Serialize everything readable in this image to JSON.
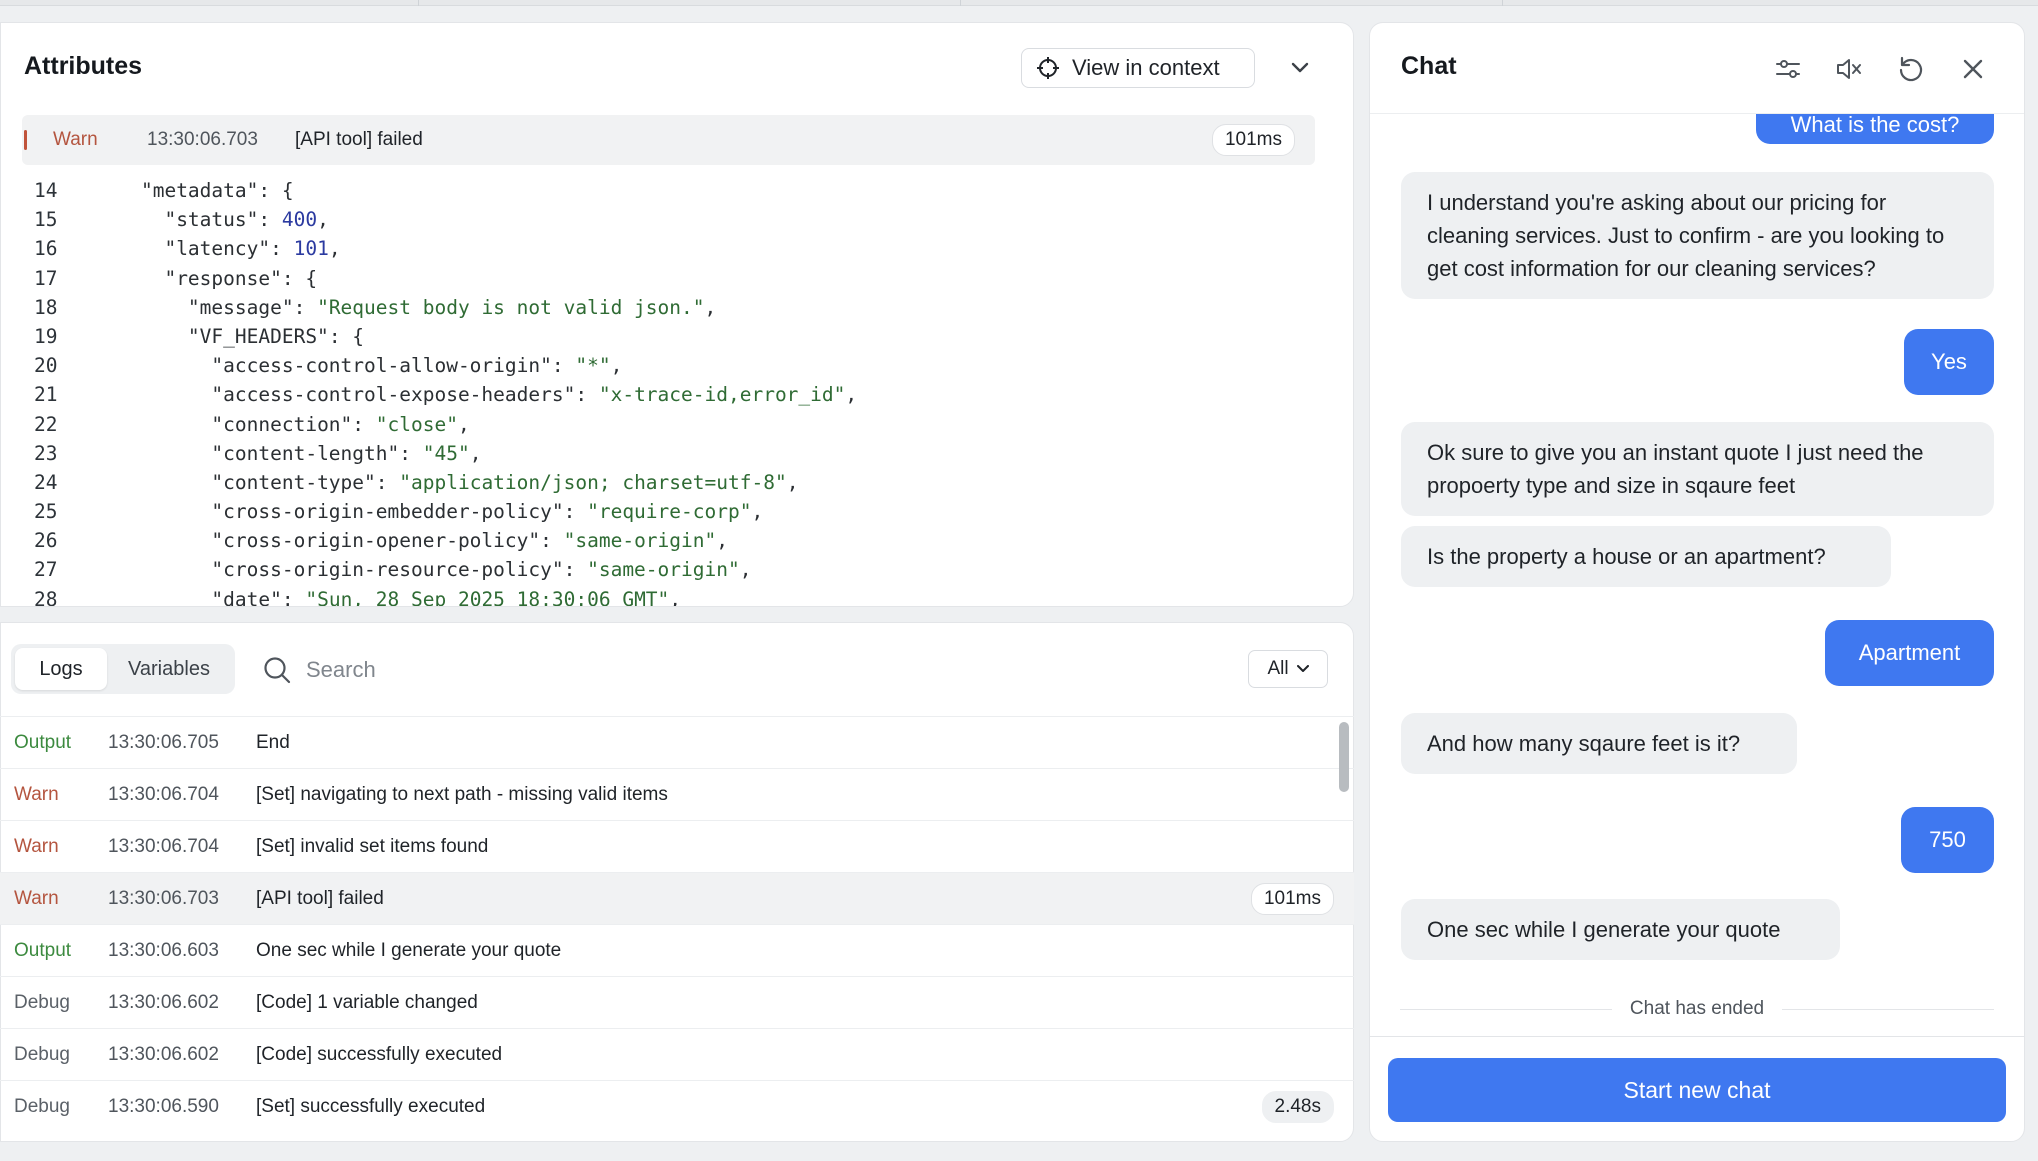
{
  "attributes": {
    "title": "Attributes",
    "view_in_context": "View in context",
    "selected_log": {
      "level": "Warn",
      "timestamp": "13:30:06.703",
      "message": "[API tool] failed",
      "duration": "101ms"
    },
    "code_lines": [
      {
        "n": "14",
        "parts": [
          {
            "t": "p",
            "v": "    "
          },
          {
            "t": "key",
            "v": "\"metadata\""
          },
          {
            "t": "p",
            "v": ": {"
          }
        ]
      },
      {
        "n": "15",
        "parts": [
          {
            "t": "p",
            "v": "      "
          },
          {
            "t": "key",
            "v": "\"status\""
          },
          {
            "t": "p",
            "v": ": "
          },
          {
            "t": "num",
            "v": "400"
          },
          {
            "t": "p",
            "v": ","
          }
        ]
      },
      {
        "n": "16",
        "parts": [
          {
            "t": "p",
            "v": "      "
          },
          {
            "t": "key",
            "v": "\"latency\""
          },
          {
            "t": "p",
            "v": ": "
          },
          {
            "t": "num",
            "v": "101"
          },
          {
            "t": "p",
            "v": ","
          }
        ]
      },
      {
        "n": "17",
        "parts": [
          {
            "t": "p",
            "v": "      "
          },
          {
            "t": "key",
            "v": "\"response\""
          },
          {
            "t": "p",
            "v": ": {"
          }
        ]
      },
      {
        "n": "18",
        "parts": [
          {
            "t": "p",
            "v": "        "
          },
          {
            "t": "key",
            "v": "\"message\""
          },
          {
            "t": "p",
            "v": ": "
          },
          {
            "t": "str",
            "v": "\"Request body is not valid json.\""
          },
          {
            "t": "p",
            "v": ","
          }
        ]
      },
      {
        "n": "19",
        "parts": [
          {
            "t": "p",
            "v": "        "
          },
          {
            "t": "key",
            "v": "\"VF_HEADERS\""
          },
          {
            "t": "p",
            "v": ": {"
          }
        ]
      },
      {
        "n": "20",
        "parts": [
          {
            "t": "p",
            "v": "          "
          },
          {
            "t": "key",
            "v": "\"access-control-allow-origin\""
          },
          {
            "t": "p",
            "v": ": "
          },
          {
            "t": "str",
            "v": "\"*\""
          },
          {
            "t": "p",
            "v": ","
          }
        ]
      },
      {
        "n": "21",
        "parts": [
          {
            "t": "p",
            "v": "          "
          },
          {
            "t": "key",
            "v": "\"access-control-expose-headers\""
          },
          {
            "t": "p",
            "v": ": "
          },
          {
            "t": "str",
            "v": "\"x-trace-id,error_id\""
          },
          {
            "t": "p",
            "v": ","
          }
        ]
      },
      {
        "n": "22",
        "parts": [
          {
            "t": "p",
            "v": "          "
          },
          {
            "t": "key",
            "v": "\"connection\""
          },
          {
            "t": "p",
            "v": ": "
          },
          {
            "t": "str",
            "v": "\"close\""
          },
          {
            "t": "p",
            "v": ","
          }
        ]
      },
      {
        "n": "23",
        "parts": [
          {
            "t": "p",
            "v": "          "
          },
          {
            "t": "key",
            "v": "\"content-length\""
          },
          {
            "t": "p",
            "v": ": "
          },
          {
            "t": "str",
            "v": "\"45\""
          },
          {
            "t": "p",
            "v": ","
          }
        ]
      },
      {
        "n": "24",
        "parts": [
          {
            "t": "p",
            "v": "          "
          },
          {
            "t": "key",
            "v": "\"content-type\""
          },
          {
            "t": "p",
            "v": ": "
          },
          {
            "t": "str",
            "v": "\"application/json; charset=utf-8\""
          },
          {
            "t": "p",
            "v": ","
          }
        ]
      },
      {
        "n": "25",
        "parts": [
          {
            "t": "p",
            "v": "          "
          },
          {
            "t": "key",
            "v": "\"cross-origin-embedder-policy\""
          },
          {
            "t": "p",
            "v": ": "
          },
          {
            "t": "str",
            "v": "\"require-corp\""
          },
          {
            "t": "p",
            "v": ","
          }
        ]
      },
      {
        "n": "26",
        "parts": [
          {
            "t": "p",
            "v": "          "
          },
          {
            "t": "key",
            "v": "\"cross-origin-opener-policy\""
          },
          {
            "t": "p",
            "v": ": "
          },
          {
            "t": "str",
            "v": "\"same-origin\""
          },
          {
            "t": "p",
            "v": ","
          }
        ]
      },
      {
        "n": "27",
        "parts": [
          {
            "t": "p",
            "v": "          "
          },
          {
            "t": "key",
            "v": "\"cross-origin-resource-policy\""
          },
          {
            "t": "p",
            "v": ": "
          },
          {
            "t": "str",
            "v": "\"same-origin\""
          },
          {
            "t": "p",
            "v": ","
          }
        ]
      },
      {
        "n": "28",
        "parts": [
          {
            "t": "p",
            "v": "          "
          },
          {
            "t": "key",
            "v": "\"date\""
          },
          {
            "t": "p",
            "v": ": "
          },
          {
            "t": "str",
            "v": "\"Sun, 28 Sep 2025 18:30:06 GMT\""
          },
          {
            "t": "p",
            "v": ","
          }
        ]
      }
    ]
  },
  "logs": {
    "tabs": {
      "logs": "Logs",
      "variables": "Variables"
    },
    "search_placeholder": "Search",
    "filter": "All",
    "rows": [
      {
        "level": "Output",
        "timestamp": "13:30:06.705",
        "message": "End"
      },
      {
        "level": "Warn",
        "timestamp": "13:30:06.704",
        "message": "[Set] navigating to next path - missing valid items"
      },
      {
        "level": "Warn",
        "timestamp": "13:30:06.704",
        "message": "[Set] invalid set items found"
      },
      {
        "level": "Warn",
        "timestamp": "13:30:06.703",
        "message": "[API tool] failed",
        "duration": "101ms"
      },
      {
        "level": "Output",
        "timestamp": "13:30:06.603",
        "message": "One sec while I generate your quote"
      },
      {
        "level": "Debug",
        "timestamp": "13:30:06.602",
        "message": "[Code] 1 variable changed"
      },
      {
        "level": "Debug",
        "timestamp": "13:30:06.602",
        "message": "[Code] successfully executed"
      },
      {
        "level": "Debug",
        "timestamp": "13:30:06.590",
        "message": "[Set] successfully executed",
        "duration": "2.48s"
      }
    ]
  },
  "chat": {
    "title": "Chat",
    "icons": [
      "sliders-icon",
      "mute-icon",
      "restart-icon",
      "close-icon"
    ],
    "messages": {
      "m0": "What is the cost?",
      "m1": "I understand you're asking about our pricing for cleaning services. Just to confirm - are you looking to get cost information for our cleaning services?",
      "m2": "Yes",
      "m3": "Ok sure to give you an instant quote I just need the propoerty type and size in sqaure feet",
      "m4": "Is the property a house or an apartment?",
      "m5": "Apartment",
      "m6": "And how many sqaure feet is it?",
      "m7": "750",
      "m8": "One sec while I generate your quote"
    },
    "ended_label": "Chat has ended",
    "start_new": "Start new chat"
  },
  "colors": {
    "accent": "#3f78f0",
    "warn": "#b4553f",
    "output": "#3c8a3f",
    "debug": "#5b6168"
  }
}
